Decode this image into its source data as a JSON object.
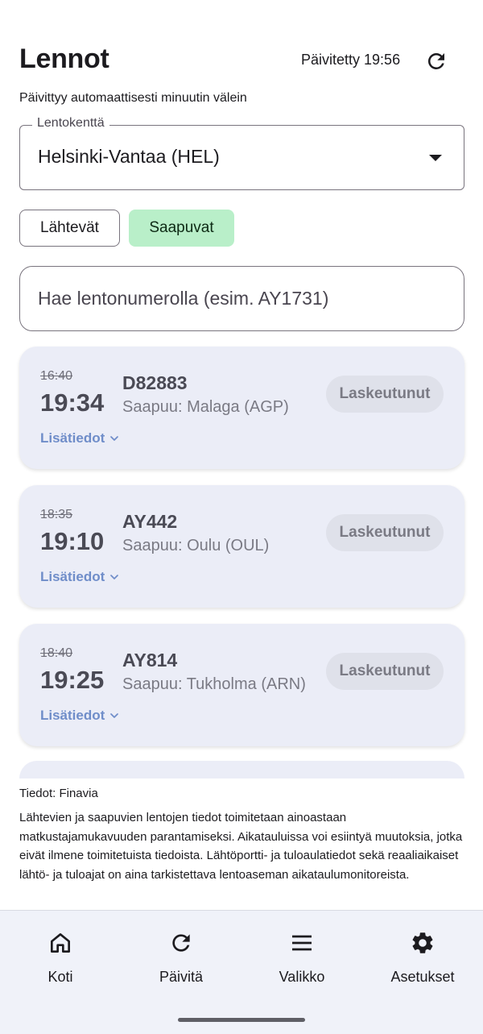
{
  "header": {
    "title": "Lennot",
    "updated": "Päivitetty 19:56",
    "subtitle": "Päivittyy automaattisesti minuutin välein"
  },
  "airport_select": {
    "label": "Lentokenttä",
    "value": "Helsinki-Vantaa (HEL)"
  },
  "mode_tabs": {
    "departures": "Lähtevät",
    "arrivals": "Saapuvat",
    "selected": "arrivals"
  },
  "search": {
    "placeholder": "Hae lentonumerolla (esim. AY1731)"
  },
  "flights": [
    {
      "scheduled": "16:40",
      "actual": "19:34",
      "number": "D82883",
      "origin": "Saapuu: Malaga (AGP)",
      "status": "Laskeutunut",
      "more": "Lisätiedot"
    },
    {
      "scheduled": "18:35",
      "actual": "19:10",
      "number": "AY442",
      "origin": "Saapuu: Oulu (OUL)",
      "status": "Laskeutunut",
      "more": "Lisätiedot"
    },
    {
      "scheduled": "18:40",
      "actual": "19:25",
      "number": "AY814",
      "origin": "Saapuu: Tukholma (ARN)",
      "status": "Laskeutunut",
      "more": "Lisätiedot"
    }
  ],
  "footer": {
    "source": "Tiedot: Finavia",
    "disclaimer": "Lähtevien ja saapuvien lentojen tiedot toimitetaan ainoastaan matkustajamukavuuden parantamiseksi. Aikatauluissa voi esiintyä muutoksia, jotka eivät ilmene toimitetuista tiedoista. Lähtöportti- ja tuloaulatiedot sekä reaaliaikaiset lähtö- ja tuloajat on aina tarkistettava lentoaseman aikataulumonitoreista."
  },
  "bottom_nav": [
    {
      "label": "Koti",
      "icon": "home-icon"
    },
    {
      "label": "Päivitä",
      "icon": "refresh-icon"
    },
    {
      "label": "Valikko",
      "icon": "menu-icon"
    },
    {
      "label": "Asetukset",
      "icon": "settings-icon"
    }
  ],
  "colors": {
    "selected_tab": "#b9efc9",
    "card": "#ebedf7",
    "link": "#6f8dc9"
  }
}
